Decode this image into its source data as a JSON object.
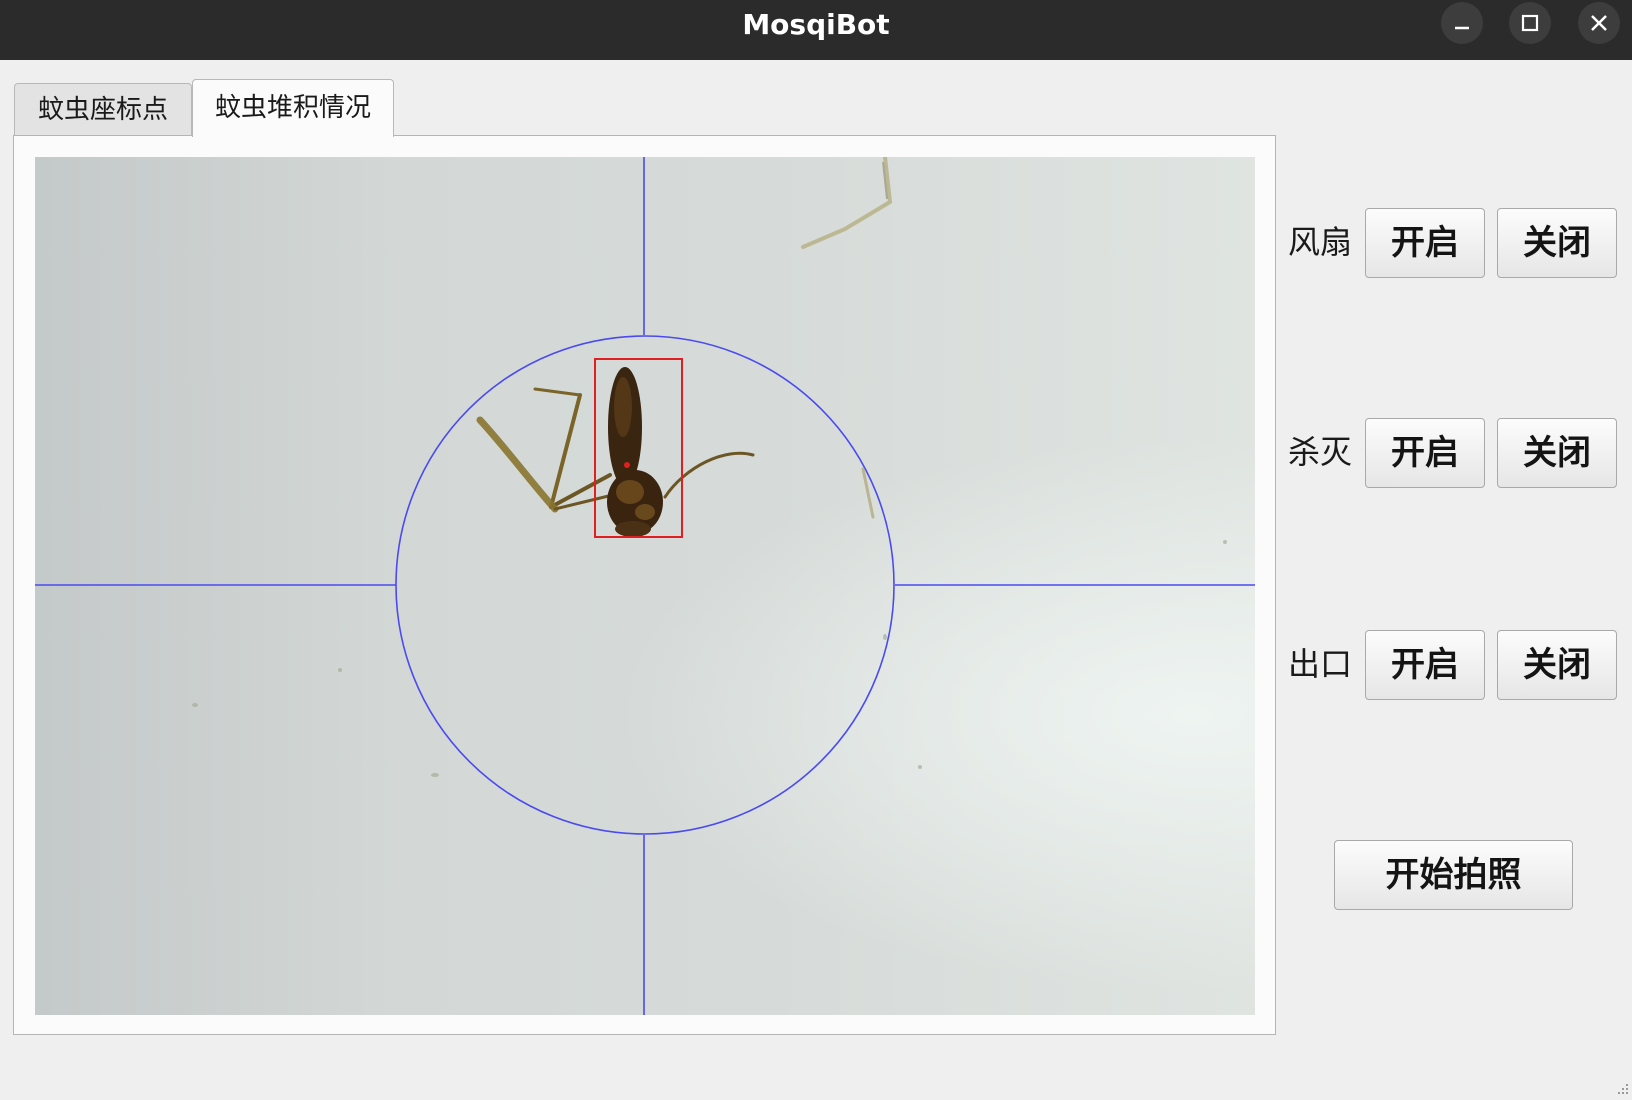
{
  "window": {
    "title": "MosqiBot"
  },
  "tabs": [
    {
      "label": "蚊虫座标点",
      "active": false
    },
    {
      "label": "蚊虫堆积情况",
      "active": true
    }
  ],
  "controls": [
    {
      "label": "风扇",
      "on": "开启",
      "off": "关闭"
    },
    {
      "label": "杀灭",
      "on": "开启",
      "off": "关闭"
    },
    {
      "label": "出口",
      "on": "开启",
      "off": "关闭"
    }
  ],
  "photo_button": "开始拍照",
  "colors": {
    "overlay_lines": "#4a4af0",
    "detection_box": "#e02020",
    "titlebar": "#2b2b2b"
  },
  "icons": [
    "minimize-icon",
    "maximize-icon",
    "close-icon"
  ]
}
